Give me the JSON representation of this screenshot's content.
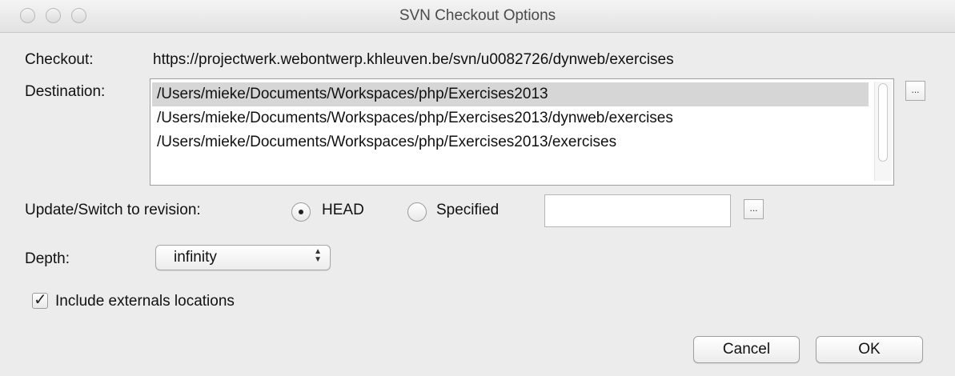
{
  "window": {
    "title": "SVN Checkout Options"
  },
  "checkout": {
    "label": "Checkout:",
    "url": "https://projectwerk.webontwerp.khleuven.be/svn/u0082726/dynweb/exercises"
  },
  "destination": {
    "label": "Destination:",
    "items": [
      "/Users/mieke/Documents/Workspaces/php/Exercises2013",
      "/Users/mieke/Documents/Workspaces/php/Exercises2013/dynweb/exercises",
      "/Users/mieke/Documents/Workspaces/php/Exercises2013/exercises"
    ],
    "selected_index": 0,
    "browse_label": "..."
  },
  "revision": {
    "label": "Update/Switch to revision:",
    "options": [
      {
        "label": "HEAD",
        "selected": true
      },
      {
        "label": "Specified",
        "selected": false
      }
    ],
    "specified_value": "",
    "browse_label": "..."
  },
  "depth": {
    "label": "Depth:",
    "value": "infinity"
  },
  "externals": {
    "label": "Include externals locations",
    "checked": true
  },
  "buttons": {
    "cancel": "Cancel",
    "ok": "OK"
  },
  "icons": {
    "window_controls": [
      "close-icon",
      "minimize-icon",
      "zoom-icon"
    ],
    "popup_arrows": "updown-arrows-icon",
    "checkmark": "checkmark-icon"
  }
}
